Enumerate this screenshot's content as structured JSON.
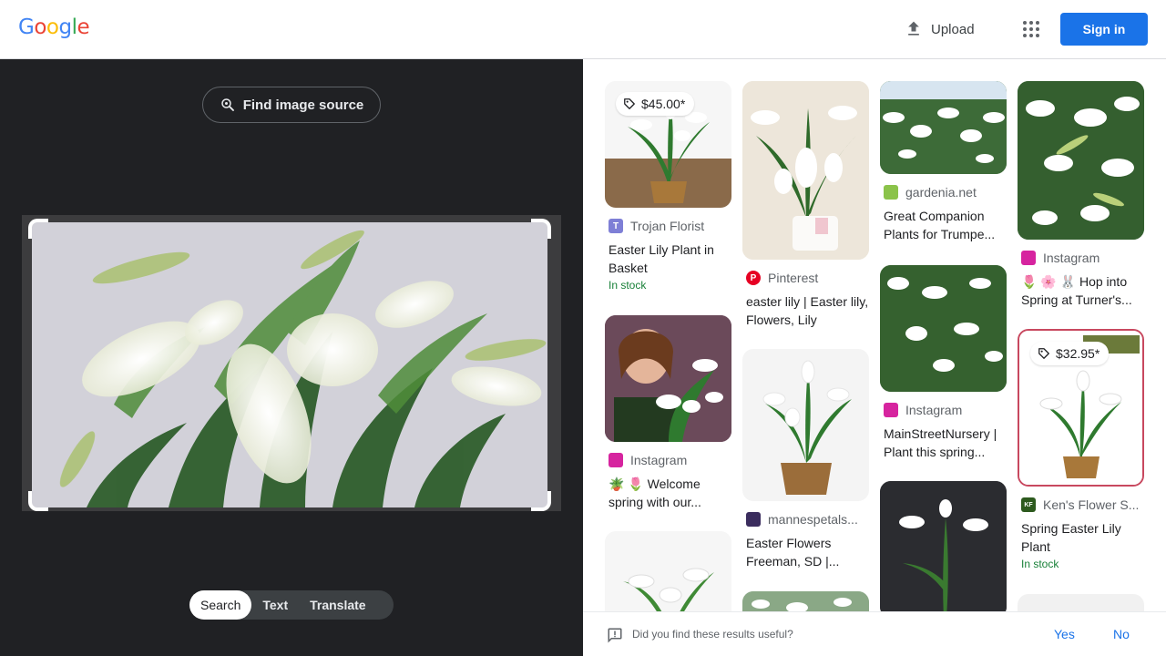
{
  "header": {
    "logo": "Google",
    "upload_label": "Upload",
    "signin_label": "Sign in"
  },
  "left_panel": {
    "find_source_label": "Find image source",
    "modes": [
      "Search",
      "Text",
      "Translate"
    ],
    "active_mode": "Search"
  },
  "results": [
    {
      "price": "$45.00*",
      "source": "Trojan Florist",
      "favicon": "T",
      "favicon_color": "#7e7fd6",
      "title": "Easter Lily Plant in Basket",
      "stock": "In stock"
    },
    {
      "source": "Pinterest",
      "favicon_color": "#e60023",
      "title": "easter lily | Easter lily, Flowers, Lily"
    },
    {
      "source": "gardenia.net",
      "favicon_color": "#8bc34a",
      "title": "Great Companion Plants for Trumpe..."
    },
    {
      "source": "Instagram",
      "favicon_color": "#d6249f",
      "title": "🌷 🌸 🐰 Hop into Spring at Turner's..."
    },
    {
      "source": "Instagram",
      "favicon_color": "#d6249f",
      "title": "🪴 🌷 Welcome spring with our..."
    },
    {
      "source": "mannespetals...",
      "favicon_color": "#3b2d5e",
      "title": "Easter Flowers Freeman, SD |..."
    },
    {
      "source": "Instagram",
      "favicon_color": "#d6249f",
      "title": "MainStreetNursery | Plant this spring..."
    },
    {
      "price": "$32.95*",
      "source": "Ken's Flower S...",
      "favicon": "KF",
      "favicon_color": "#2d5a1e",
      "title": "Spring Easter Lily Plant",
      "stock": "In stock"
    }
  ],
  "feedback": {
    "question": "Did you find these results useful?",
    "yes": "Yes",
    "no": "No"
  }
}
